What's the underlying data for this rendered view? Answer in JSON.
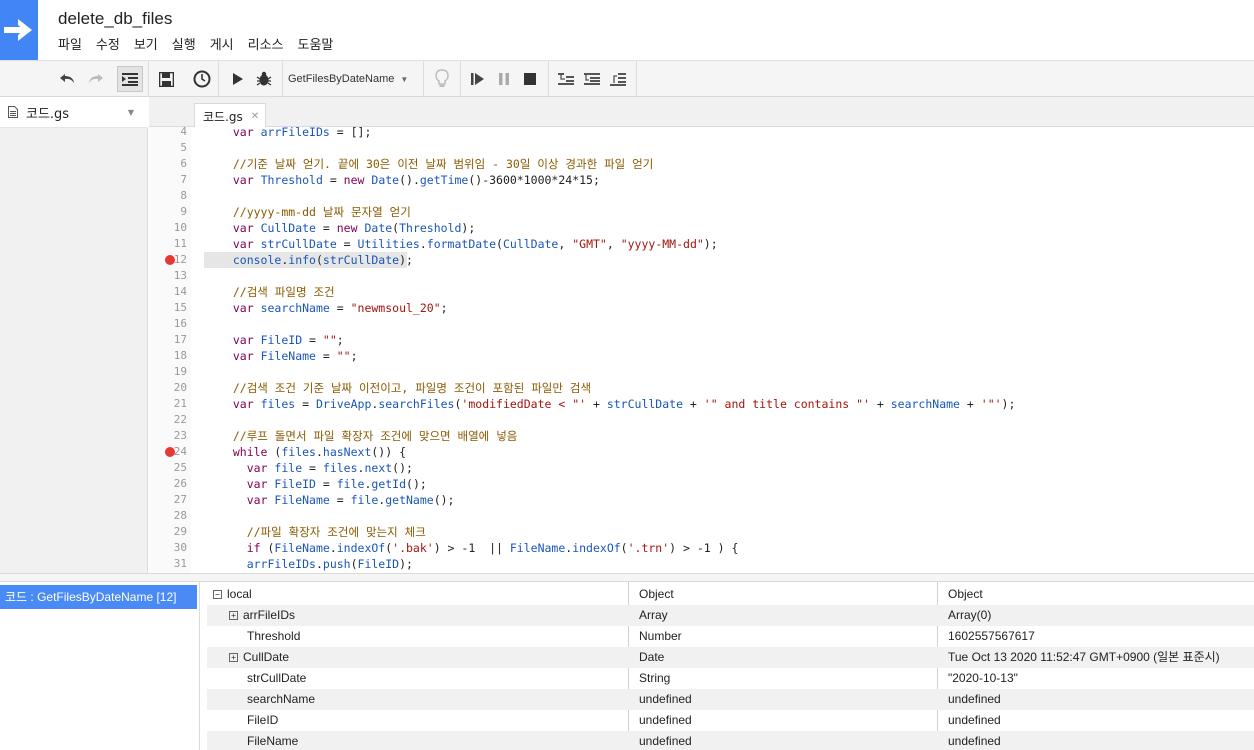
{
  "header": {
    "title": "delete_db_files",
    "menu": [
      "파일",
      "수정",
      "보기",
      "실행",
      "게시",
      "리소스",
      "도움말"
    ]
  },
  "toolbar": {
    "function_select": "GetFilesByDateName",
    "buttons": [
      "undo-icon",
      "redo-icon",
      "indent-icon",
      "save-icon",
      "triggers-clock-icon",
      "run-icon",
      "debug-bug-icon",
      "lightbulb-icon",
      "continue-icon",
      "pause-icon",
      "stop-icon",
      "step-into-icon",
      "step-over-icon",
      "step-out-icon"
    ]
  },
  "file_panel": {
    "file_label": "코드.gs"
  },
  "editor": {
    "tab_label": "코드.gs",
    "lines": [
      {
        "n": "4",
        "text": "  var arrFileIDs = [];",
        "bp": false
      },
      {
        "n": "5",
        "text": "",
        "bp": false
      },
      {
        "n": "6",
        "text": "  //기준 날짜 얻기. 끝에 30은 이전 날짜 범위임 - 30일 이상 경과한 파일 얻기",
        "bp": false
      },
      {
        "n": "7",
        "text": "  var Threshold = new Date().getTime()-3600*1000*24*15;",
        "bp": false
      },
      {
        "n": "8",
        "text": "",
        "bp": false
      },
      {
        "n": "9",
        "text": "  //yyyy-mm-dd 날짜 문자열 얻기",
        "bp": false
      },
      {
        "n": "10",
        "text": "  var CullDate = new Date(Threshold);",
        "bp": false
      },
      {
        "n": "11",
        "text": "  var strCullDate = Utilities.formatDate(CullDate, \"GMT\", \"yyyy-MM-dd\");",
        "bp": false
      },
      {
        "n": "12",
        "text": "  console.info(strCullDate);",
        "bp": true
      },
      {
        "n": "13",
        "text": "",
        "bp": false
      },
      {
        "n": "14",
        "text": "  //검색 파일명 조건",
        "bp": false
      },
      {
        "n": "15",
        "text": "  var searchName = \"newmsoul_20\";",
        "bp": false
      },
      {
        "n": "16",
        "text": "",
        "bp": false
      },
      {
        "n": "17",
        "text": "  var FileID = \"\";",
        "bp": false
      },
      {
        "n": "18",
        "text": "  var FileName = \"\";",
        "bp": false
      },
      {
        "n": "19",
        "text": "",
        "bp": false
      },
      {
        "n": "20",
        "text": "  //검색 조건 기준 날짜 이전이고, 파일명 조건이 포함된 파일만 검색",
        "bp": false
      },
      {
        "n": "21",
        "text": "  var files = DriveApp.searchFiles('modifiedDate < \"' + strCullDate + '\" and title contains \"' + searchName + '\"');",
        "bp": false
      },
      {
        "n": "22",
        "text": "",
        "bp": false
      },
      {
        "n": "23",
        "text": "  //루프 돌면서 파일 확장자 조건에 맞으면 배열에 넣음",
        "bp": false
      },
      {
        "n": "24",
        "text": "  while (files.hasNext()) {",
        "bp": true
      },
      {
        "n": "25",
        "text": "    var file = files.next();",
        "bp": false
      },
      {
        "n": "26",
        "text": "    var FileID = file.getId();",
        "bp": false
      },
      {
        "n": "27",
        "text": "    var FileName = file.getName();",
        "bp": false
      },
      {
        "n": "28",
        "text": "",
        "bp": false
      },
      {
        "n": "29",
        "text": "    //파일 확장자 조건에 맞는지 체크",
        "bp": false
      },
      {
        "n": "30",
        "text": "    if (FileName.indexOf('.bak') > -1  || FileName.indexOf('.trn') > -1 ) {",
        "bp": false
      },
      {
        "n": "31",
        "text": "    arrFileIDs.push(FileID);",
        "bp": false
      }
    ]
  },
  "debugger": {
    "call_stack": [
      "코드 : GetFilesByDateName [12]"
    ],
    "variables": [
      {
        "name": "local",
        "type": "Object",
        "value": "Object",
        "expander": "minus",
        "indent": 0
      },
      {
        "name": "arrFileIDs",
        "type": "Array",
        "value": "Array(0)",
        "expander": "plus",
        "indent": 1
      },
      {
        "name": "Threshold",
        "type": "Number",
        "value": "1602557567617",
        "expander": "none",
        "indent": 1
      },
      {
        "name": "CullDate",
        "type": "Date",
        "value": "Tue Oct 13 2020 11:52:47 GMT+0900 (일본 표준시)",
        "expander": "plus",
        "indent": 1
      },
      {
        "name": "strCullDate",
        "type": "String",
        "value": "\"2020-10-13\"",
        "expander": "none",
        "indent": 1
      },
      {
        "name": "searchName",
        "type": "undefined",
        "value": "undefined",
        "expander": "none",
        "indent": 1
      },
      {
        "name": "FileID",
        "type": "undefined",
        "value": "undefined",
        "expander": "none",
        "indent": 1
      },
      {
        "name": "FileName",
        "type": "undefined",
        "value": "undefined",
        "expander": "none",
        "indent": 1
      }
    ]
  },
  "colors": {
    "accent": "#4285f4",
    "frame_highlight": "#4a8af4",
    "breakpoint": "#e53935",
    "keyword": "#7f0055",
    "variable": "#1a56b8",
    "string": "#a3160e",
    "comment": "#8a5a00"
  }
}
